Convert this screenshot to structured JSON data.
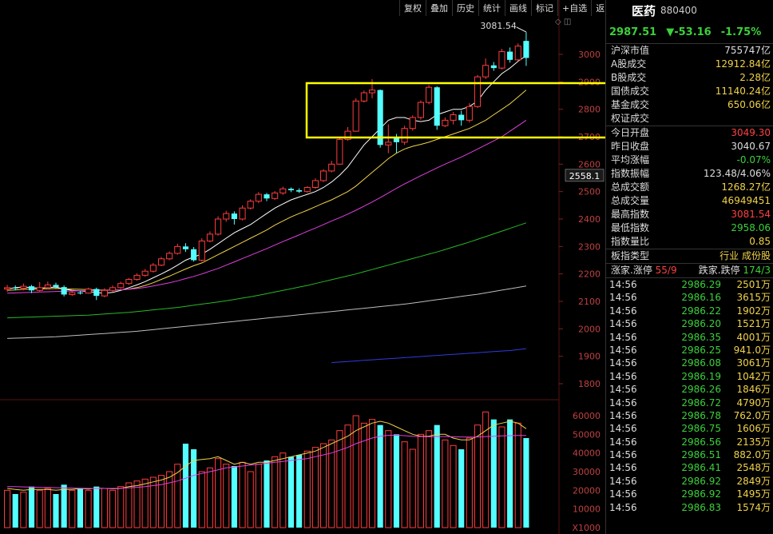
{
  "toolbar": [
    "复权",
    "叠加",
    "历史",
    "统计",
    "画线",
    "标记",
    "+自选",
    "返回"
  ],
  "chart": {
    "price_axis": [
      "3000",
      "2900",
      "2800",
      "2700",
      "2600",
      "2500",
      "2400",
      "2300",
      "2200",
      "2100",
      "2000",
      "1900",
      "1800"
    ],
    "price_marker": "2558.1",
    "max_label": "3081.54",
    "vol_axis": [
      "60000",
      "50000",
      "40000",
      "30000",
      "20000",
      "10000",
      "X1000"
    ]
  },
  "chart_data": {
    "type": "candlestick",
    "price_ylim": [
      1800,
      3000
    ],
    "candles": [
      {
        "o": 2145,
        "c": 2150,
        "h": 2160,
        "l": 2135
      },
      {
        "o": 2150,
        "c": 2148,
        "h": 2158,
        "l": 2140
      },
      {
        "o": 2148,
        "c": 2155,
        "h": 2165,
        "l": 2140
      },
      {
        "o": 2155,
        "c": 2140,
        "h": 2160,
        "l": 2130
      },
      {
        "o": 2140,
        "c": 2150,
        "h": 2170,
        "l": 2135
      },
      {
        "o": 2150,
        "c": 2160,
        "h": 2172,
        "l": 2145
      },
      {
        "o": 2160,
        "c": 2152,
        "h": 2168,
        "l": 2148
      },
      {
        "o": 2152,
        "c": 2125,
        "h": 2158,
        "l": 2118
      },
      {
        "o": 2125,
        "c": 2132,
        "h": 2140,
        "l": 2120
      },
      {
        "o": 2132,
        "c": 2130,
        "h": 2138,
        "l": 2125
      },
      {
        "o": 2130,
        "c": 2145,
        "h": 2150,
        "l": 2128
      },
      {
        "o": 2145,
        "c": 2120,
        "h": 2150,
        "l": 2105
      },
      {
        "o": 2120,
        "c": 2140,
        "h": 2148,
        "l": 2115
      },
      {
        "o": 2140,
        "c": 2150,
        "h": 2158,
        "l": 2135
      },
      {
        "o": 2150,
        "c": 2165,
        "h": 2172,
        "l": 2145
      },
      {
        "o": 2165,
        "c": 2180,
        "h": 2185,
        "l": 2160
      },
      {
        "o": 2180,
        "c": 2195,
        "h": 2202,
        "l": 2175
      },
      {
        "o": 2195,
        "c": 2210,
        "h": 2218,
        "l": 2190
      },
      {
        "o": 2210,
        "c": 2232,
        "h": 2240,
        "l": 2205
      },
      {
        "o": 2232,
        "c": 2255,
        "h": 2262,
        "l": 2228
      },
      {
        "o": 2255,
        "c": 2275,
        "h": 2282,
        "l": 2250
      },
      {
        "o": 2275,
        "c": 2300,
        "h": 2310,
        "l": 2270
      },
      {
        "o": 2300,
        "c": 2290,
        "h": 2312,
        "l": 2280
      },
      {
        "o": 2290,
        "c": 2250,
        "h": 2298,
        "l": 2245
      },
      {
        "o": 2250,
        "c": 2320,
        "h": 2330,
        "l": 2245
      },
      {
        "o": 2320,
        "c": 2345,
        "h": 2355,
        "l": 2315
      },
      {
        "o": 2345,
        "c": 2400,
        "h": 2410,
        "l": 2340
      },
      {
        "o": 2400,
        "c": 2420,
        "h": 2430,
        "l": 2390
      },
      {
        "o": 2420,
        "c": 2400,
        "h": 2428,
        "l": 2380
      },
      {
        "o": 2400,
        "c": 2440,
        "h": 2450,
        "l": 2395
      },
      {
        "o": 2440,
        "c": 2465,
        "h": 2472,
        "l": 2435
      },
      {
        "o": 2465,
        "c": 2490,
        "h": 2498,
        "l": 2458
      },
      {
        "o": 2490,
        "c": 2475,
        "h": 2495,
        "l": 2465
      },
      {
        "o": 2475,
        "c": 2495,
        "h": 2502,
        "l": 2470
      },
      {
        "o": 2495,
        "c": 2510,
        "h": 2518,
        "l": 2488
      },
      {
        "o": 2510,
        "c": 2505,
        "h": 2515,
        "l": 2498
      },
      {
        "o": 2505,
        "c": 2500,
        "h": 2512,
        "l": 2495
      },
      {
        "o": 2500,
        "c": 2515,
        "h": 2520,
        "l": 2496
      },
      {
        "o": 2515,
        "c": 2540,
        "h": 2548,
        "l": 2510
      },
      {
        "o": 2540,
        "c": 2575,
        "h": 2582,
        "l": 2535
      },
      {
        "o": 2575,
        "c": 2600,
        "h": 2612,
        "l": 2570
      },
      {
        "o": 2600,
        "c": 2690,
        "h": 2700,
        "l": 2598
      },
      {
        "o": 2690,
        "c": 2720,
        "h": 2735,
        "l": 2685
      },
      {
        "o": 2720,
        "c": 2830,
        "h": 2840,
        "l": 2718
      },
      {
        "o": 2830,
        "c": 2860,
        "h": 2868,
        "l": 2825
      },
      {
        "o": 2860,
        "c": 2870,
        "h": 2910,
        "l": 2840
      },
      {
        "o": 2870,
        "c": 2670,
        "h": 2872,
        "l": 2660
      },
      {
        "o": 2670,
        "c": 2680,
        "h": 2745,
        "l": 2640
      },
      {
        "o": 2700,
        "c": 2680,
        "h": 2710,
        "l": 2640
      },
      {
        "o": 2680,
        "c": 2730,
        "h": 2740,
        "l": 2670
      },
      {
        "o": 2730,
        "c": 2770,
        "h": 2778,
        "l": 2722
      },
      {
        "o": 2770,
        "c": 2825,
        "h": 2832,
        "l": 2762
      },
      {
        "o": 2825,
        "c": 2880,
        "h": 2888,
        "l": 2818
      },
      {
        "o": 2880,
        "c": 2740,
        "h": 2884,
        "l": 2725
      },
      {
        "o": 2740,
        "c": 2760,
        "h": 2770,
        "l": 2735
      },
      {
        "o": 2760,
        "c": 2780,
        "h": 2790,
        "l": 2745
      },
      {
        "o": 2780,
        "c": 2760,
        "h": 2795,
        "l": 2740
      },
      {
        "o": 2760,
        "c": 2810,
        "h": 2822,
        "l": 2752
      },
      {
        "o": 2810,
        "c": 2918,
        "h": 2925,
        "l": 2805
      },
      {
        "o": 2918,
        "c": 2960,
        "h": 2985,
        "l": 2910
      },
      {
        "o": 2960,
        "c": 2950,
        "h": 2972,
        "l": 2940
      },
      {
        "o": 2950,
        "c": 3010,
        "h": 3020,
        "l": 2945
      },
      {
        "o": 3010,
        "c": 2980,
        "h": 3025,
        "l": 2970
      },
      {
        "o": 2980,
        "c": 3030,
        "h": 3040,
        "l": 2975
      },
      {
        "o": 3049,
        "c": 2987,
        "h": 3081,
        "l": 2958
      }
    ],
    "ma_series": [
      {
        "color": "#ffffff",
        "values": [
          2145,
          2150,
          2152,
          2150,
          2148,
          2150,
          2152,
          2145,
          2140,
          2138,
          2136,
          2132,
          2130,
          2133,
          2140,
          2150,
          2160,
          2172,
          2186,
          2200,
          2215,
          2232,
          2250,
          2262,
          2272,
          2290,
          2310,
          2330,
          2350,
          2365,
          2380,
          2400,
          2420,
          2440,
          2455,
          2470,
          2480,
          2490,
          2500,
          2515,
          2535,
          2560,
          2590,
          2630,
          2670,
          2700,
          2730,
          2760,
          2770,
          2770,
          2760,
          2755,
          2760,
          2780,
          2790,
          2800,
          2800,
          2810,
          2830,
          2870,
          2900,
          2930,
          2950,
          2975,
          2995
        ]
      },
      {
        "color": "#f0d24a",
        "values": [
          2140,
          2142,
          2144,
          2145,
          2146,
          2146,
          2147,
          2146,
          2145,
          2144,
          2143,
          2142,
          2141,
          2141,
          2142,
          2145,
          2150,
          2158,
          2168,
          2180,
          2192,
          2205,
          2218,
          2230,
          2240,
          2255,
          2270,
          2285,
          2300,
          2315,
          2330,
          2345,
          2360,
          2378,
          2393,
          2408,
          2420,
          2432,
          2445,
          2458,
          2470,
          2485,
          2500,
          2520,
          2545,
          2570,
          2595,
          2620,
          2640,
          2655,
          2665,
          2672,
          2680,
          2690,
          2700,
          2710,
          2720,
          2730,
          2745,
          2760,
          2780,
          2800,
          2820,
          2845,
          2870
        ]
      },
      {
        "color": "#e040e0",
        "values": [
          2130,
          2131,
          2132,
          2133,
          2134,
          2135,
          2136,
          2137,
          2138,
          2139,
          2139,
          2140,
          2140,
          2141,
          2142,
          2144,
          2147,
          2151,
          2156,
          2162,
          2168,
          2175,
          2183,
          2191,
          2200,
          2210,
          2220,
          2232,
          2244,
          2256,
          2268,
          2280,
          2292,
          2305,
          2318,
          2330,
          2342,
          2355,
          2367,
          2380,
          2393,
          2405,
          2418,
          2432,
          2447,
          2462,
          2478,
          2495,
          2512,
          2528,
          2543,
          2558,
          2572,
          2586,
          2600,
          2613,
          2626,
          2640,
          2655,
          2670,
          2685,
          2700,
          2720,
          2740,
          2760
        ]
      },
      {
        "color": "#28b828",
        "values": [
          2040,
          2041,
          2042,
          2043,
          2044,
          2045,
          2046,
          2047,
          2048,
          2049,
          2050,
          2052,
          2054,
          2056,
          2058,
          2060,
          2063,
          2066,
          2069,
          2072,
          2075,
          2078,
          2082,
          2086,
          2090,
          2094,
          2098,
          2102,
          2107,
          2112,
          2117,
          2122,
          2128,
          2134,
          2140,
          2146,
          2152,
          2158,
          2165,
          2172,
          2179,
          2186,
          2193,
          2200,
          2208,
          2216,
          2224,
          2232,
          2240,
          2248,
          2256,
          2264,
          2272,
          2280,
          2289,
          2298,
          2307,
          2316,
          2326,
          2336,
          2346,
          2356,
          2366,
          2376,
          2386
        ]
      },
      {
        "color": "#bdbdbd",
        "values": [
          1965,
          1966,
          1967,
          1968,
          1969,
          1970,
          1971,
          1973,
          1975,
          1977,
          1979,
          1981,
          1983,
          1985,
          1987,
          1989,
          1991,
          1994,
          1997,
          2000,
          2003,
          2006,
          2009,
          2012,
          2015,
          2018,
          2021,
          2024,
          2027,
          2030,
          2033,
          2036,
          2039,
          2042,
          2045,
          2048,
          2051,
          2054,
          2057,
          2060,
          2063,
          2066,
          2069,
          2072,
          2075,
          2078,
          2081,
          2084,
          2087,
          2090,
          2094,
          2098,
          2102,
          2106,
          2110,
          2114,
          2118,
          2122,
          2126,
          2131,
          2136,
          2141,
          2146,
          2151,
          2156
        ]
      },
      {
        "color": "#2e3cdc",
        "values": [
          null,
          null,
          null,
          null,
          null,
          null,
          null,
          null,
          null,
          null,
          null,
          null,
          null,
          null,
          null,
          null,
          null,
          null,
          null,
          null,
          null,
          null,
          null,
          null,
          null,
          null,
          null,
          null,
          null,
          null,
          null,
          null,
          null,
          null,
          null,
          null,
          null,
          null,
          null,
          null,
          1877,
          1879,
          1881,
          1883,
          1885,
          1887,
          1889,
          1891,
          1893,
          1895,
          1897,
          1899,
          1901,
          1903,
          1905,
          1907,
          1909,
          1911,
          1913,
          1915,
          1917,
          1919,
          1921,
          1924,
          1928
        ]
      }
    ],
    "volume_ylim": [
      0,
      65000
    ],
    "volumes": [
      20000,
      18000,
      19000,
      22000,
      20000,
      21000,
      18000,
      23000,
      20000,
      21000,
      20000,
      22000,
      21000,
      20000,
      22000,
      24000,
      25000,
      26000,
      27000,
      28000,
      30000,
      34000,
      45000,
      42000,
      30000,
      32000,
      37000,
      34000,
      33000,
      35000,
      30000,
      34000,
      36000,
      38000,
      40000,
      38000,
      39000,
      41000,
      43000,
      45000,
      47000,
      52000,
      55000,
      60000,
      56000,
      58000,
      55000,
      52000,
      50000,
      46000,
      42000,
      50000,
      52000,
      55000,
      47000,
      44000,
      42000,
      48000,
      55000,
      62000,
      58000,
      54000,
      58000,
      56000,
      48000
    ],
    "vol_ma": [
      {
        "color": "#f0d24a",
        "values": [
          21000,
          20500,
          20000,
          20500,
          20500,
          20500,
          20000,
          20500,
          20500,
          21000,
          20700,
          21200,
          21000,
          20800,
          21000,
          22000,
          22500,
          23500,
          24500,
          25500,
          27000,
          29500,
          33000,
          36000,
          36500,
          37000,
          38000,
          36000,
          34000,
          35000,
          34000,
          35000,
          35000,
          36000,
          37000,
          38000,
          39000,
          40000,
          41000,
          43000,
          45000,
          47000,
          49000,
          52000,
          54000,
          56000,
          57000,
          56000,
          54000,
          52000,
          50000,
          49000,
          49000,
          50000,
          50000,
          48000,
          47000,
          47000,
          49000,
          52000,
          55000,
          56000,
          57000,
          56000,
          53000
        ]
      },
      {
        "color": "#e040e0",
        "values": [
          22000,
          22000,
          21800,
          21700,
          21600,
          21500,
          21400,
          21300,
          21200,
          21100,
          21000,
          21000,
          21000,
          21000,
          21100,
          21300,
          21600,
          22000,
          22500,
          23000,
          24000,
          25000,
          26500,
          28000,
          29000,
          30000,
          31000,
          32000,
          32500,
          33000,
          33500,
          34000,
          34500,
          35000,
          35500,
          36000,
          36500,
          37000,
          38000,
          39000,
          40000,
          41500,
          43000,
          45000,
          46500,
          48000,
          49000,
          49500,
          49500,
          49300,
          49000,
          48800,
          48700,
          48800,
          48800,
          48700,
          48600,
          48500,
          48600,
          48800,
          49000,
          49200,
          49300,
          49400,
          49400
        ]
      }
    ]
  },
  "panel": {
    "name": "医药",
    "code": "880400",
    "price": "2987.51",
    "change": "▼-53.16",
    "pct": "-1.75%",
    "stats": [
      {
        "label": "沪深市值",
        "value": "755747亿",
        "color": "w"
      },
      {
        "label": "A股成交",
        "value": "12912.84亿",
        "color": "y"
      },
      {
        "label": "B股成交",
        "value": "2.28亿",
        "color": "y"
      },
      {
        "label": "国债成交",
        "value": "11140.24亿",
        "color": "y"
      },
      {
        "label": "基金成交",
        "value": "650.06亿",
        "color": "y"
      },
      {
        "label": "权证成交",
        "value": "",
        "color": "y"
      }
    ],
    "stats2": [
      {
        "label": "今日开盘",
        "value": "3049.30",
        "color": "r"
      },
      {
        "label": "昨日收盘",
        "value": "3040.67",
        "color": "w"
      },
      {
        "label": "平均涨幅",
        "value": "-0.07%",
        "color": "g"
      },
      {
        "label": "指数振幅",
        "value": "123.48/4.06%",
        "color": "w"
      },
      {
        "label": "总成交额",
        "value": "1268.27亿",
        "color": "y"
      },
      {
        "label": "总成交量",
        "value": "46949451",
        "color": "y"
      },
      {
        "label": "最高指数",
        "value": "3081.54",
        "color": "r"
      },
      {
        "label": "最低指数",
        "value": "2958.06",
        "color": "g"
      },
      {
        "label": "指数量比",
        "value": "0.85",
        "color": "y"
      }
    ],
    "type_label": "板指类型",
    "type_value": "行业 成份股",
    "up_label": "涨家.涨停",
    "up_value": "55/9",
    "down_label": "跌家.跌停",
    "down_value": "174/3",
    "ticks": [
      {
        "t": "14:56",
        "p": "2986.29",
        "q": "2501万"
      },
      {
        "t": "14:56",
        "p": "2986.16",
        "q": "3615万"
      },
      {
        "t": "14:56",
        "p": "2986.22",
        "q": "1902万"
      },
      {
        "t": "14:56",
        "p": "2986.20",
        "q": "1521万"
      },
      {
        "t": "14:56",
        "p": "2986.35",
        "q": "4001万"
      },
      {
        "t": "14:56",
        "p": "2986.25",
        "q": "941.0万"
      },
      {
        "t": "14:56",
        "p": "2986.08",
        "q": "3061万"
      },
      {
        "t": "14:56",
        "p": "2986.19",
        "q": "1042万"
      },
      {
        "t": "14:56",
        "p": "2986.26",
        "q": "1846万"
      },
      {
        "t": "14:56",
        "p": "2986.72",
        "q": "4790万"
      },
      {
        "t": "14:56",
        "p": "2986.78",
        "q": "762.0万"
      },
      {
        "t": "14:56",
        "p": "2986.75",
        "q": "1606万"
      },
      {
        "t": "14:56",
        "p": "2986.56",
        "q": "2135万"
      },
      {
        "t": "14:56",
        "p": "2986.51",
        "q": "882.0万"
      },
      {
        "t": "14:56",
        "p": "2986.41",
        "q": "2548万"
      },
      {
        "t": "14:56",
        "p": "2986.92",
        "q": "2849万"
      },
      {
        "t": "14:56",
        "p": "2986.92",
        "q": "1495万"
      },
      {
        "t": "14:56",
        "p": "2986.83",
        "q": "1574万"
      }
    ]
  }
}
